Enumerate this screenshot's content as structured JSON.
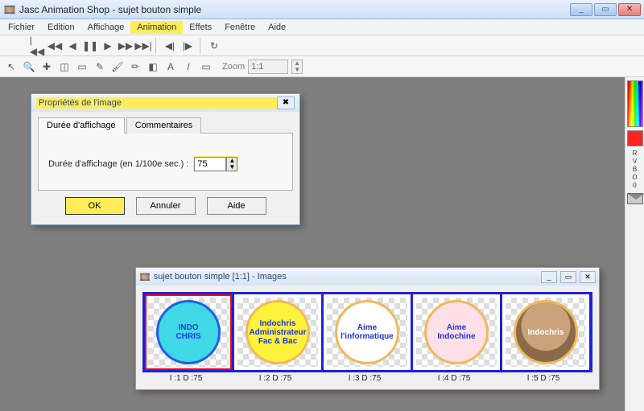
{
  "app": {
    "title": "Jasc Animation Shop - sujet bouton simple",
    "window_buttons": {
      "min": "_",
      "max": "▭",
      "close": "✕"
    }
  },
  "menu": {
    "items": [
      "Fichier",
      "Edition",
      "Affichage",
      "Animation",
      "Effets",
      "Fenêtre",
      "Aide"
    ],
    "highlighted_index": 3
  },
  "playback_toolbar": {
    "icons": [
      "first-icon",
      "prev-icon",
      "play-back-icon",
      "pause-icon",
      "play-icon",
      "next-icon",
      "last-icon",
      "",
      "step-back-icon",
      "step-fwd-icon",
      "",
      "loop-icon"
    ]
  },
  "tool_toolbar": {
    "icons": [
      "pointer-icon",
      "zoom-icon",
      "crosshair-icon",
      "crop-icon",
      "marquee-icon",
      "eyedropper-icon",
      "brush-icon",
      "pencil-icon",
      "eraser-icon",
      "text-icon",
      "line-icon",
      "rect-icon"
    ],
    "zoom_label": "Zoom",
    "zoom_value": "1:1"
  },
  "std_toolbar": {
    "groups": [
      [
        "flag-red-icon",
        "flag-blue-icon",
        "frame-add-icon",
        "frame-dup-icon"
      ],
      [
        "new-icon",
        "open-icon",
        "save-icon",
        "saveall-icon",
        "export-icon"
      ],
      [
        "undo-icon",
        "redo-icon"
      ],
      [
        "cut-icon",
        "copy-icon",
        "paste-icon",
        "paste-into-icon",
        "paste-after-icon",
        "paste-before-icon"
      ],
      [
        "fx1-icon",
        "fx2-icon",
        "fx3-icon"
      ],
      [
        "find-icon",
        "props-icon",
        "palette-icon",
        "layers-icon"
      ],
      [
        "help-icon"
      ]
    ]
  },
  "right_dock": {
    "letters": "R\nV\nB\nO\n0"
  },
  "dialog": {
    "title": "Propriétés de l'image",
    "tab1": "Durée d'affichage",
    "tab2": "Commentaires",
    "field_label": "Durée d'affichage (en 1/100e sec.) :",
    "value": "75",
    "ok": "OK",
    "cancel": "Annuler",
    "help": "Aide"
  },
  "child_window": {
    "title": "sujet bouton simple [1:1] - Images",
    "frames": [
      {
        "lines": [
          "INDO",
          "CHRIS"
        ],
        "class": "b1",
        "label": "I :1  D :75",
        "selected": true
      },
      {
        "lines": [
          "Indochris",
          "Administrateur",
          "Fac & Bac"
        ],
        "class": "b2",
        "label": "I :2  D :75",
        "selected": false
      },
      {
        "lines": [
          "Aime",
          "l'informatique"
        ],
        "class": "b3",
        "label": "I :3  D :75",
        "selected": false
      },
      {
        "lines": [
          "Aime",
          "Indochine"
        ],
        "class": "b4",
        "label": "I :4  D :75",
        "selected": false
      },
      {
        "lines": [
          "Indochris"
        ],
        "class": "b5",
        "label": "I :5  D :75",
        "selected": false
      }
    ]
  }
}
